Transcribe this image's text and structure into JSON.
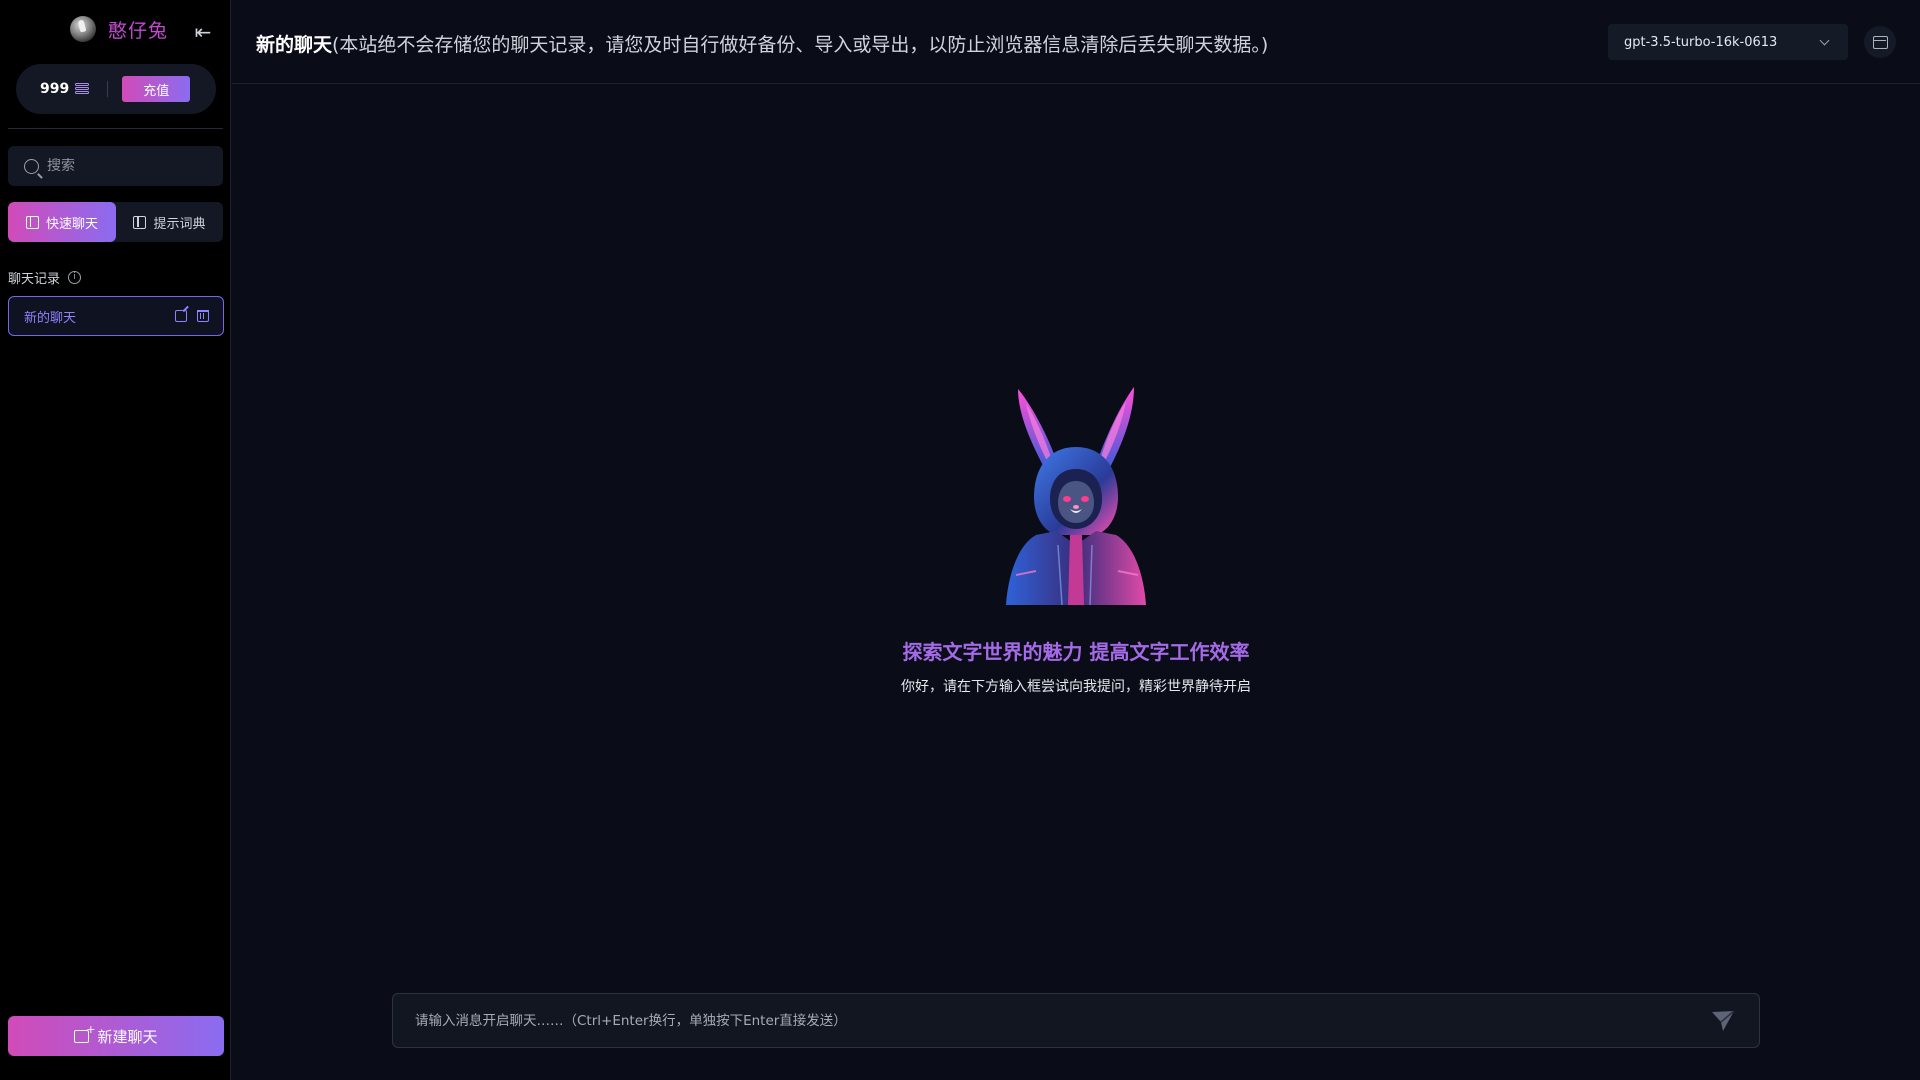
{
  "sidebar": {
    "brand_name": "憨仔兔",
    "collapse_icon": "collapse-left-icon",
    "balance": "999",
    "recharge_label": "充值",
    "search_placeholder": "搜索",
    "tabs": [
      {
        "label": "快速聊天",
        "active": true
      },
      {
        "label": "提示词典",
        "active": false
      }
    ],
    "history_label": "聊天记录",
    "chats": [
      {
        "title": "新的聊天",
        "selected": true
      }
    ],
    "new_chat_label": "新建聊天"
  },
  "header": {
    "title": "新的聊天",
    "note": "(本站绝不会存储您的聊天记录，请您及时自行做好备份、导入或导出，以防止浏览器信息清除后丢失聊天数据。)",
    "model": "gpt-3.5-turbo-16k-0613"
  },
  "main": {
    "headline": "探索文字世界的魅力  提高文字工作效率",
    "subline": "你好，请在下方输入框尝试向我提问，精彩世界静待开启"
  },
  "composer": {
    "placeholder": "请输入消息开启聊天……（Ctrl+Enter换行，单独按下Enter直接发送）"
  },
  "colors": {
    "accent_start": "#d14bb8",
    "accent_end": "#8a6cf0",
    "background": "#0a0d17",
    "sidebar_bg": "#000000"
  }
}
